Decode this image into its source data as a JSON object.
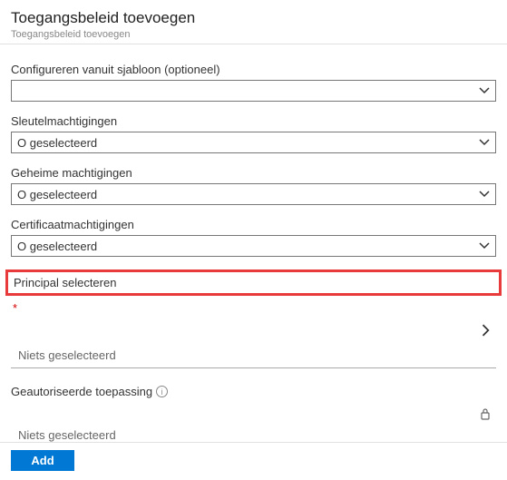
{
  "header": {
    "title": "Toegangsbeleid toevoegen",
    "subtitle": "Toegangsbeleid toevoegen"
  },
  "fields": {
    "template": {
      "label": "Configureren vanuit sjabloon (optioneel)",
      "value": ""
    },
    "key_permissions": {
      "label": "Sleutelmachtigingen",
      "value": "O geselecteerd"
    },
    "secret_permissions": {
      "label": "Geheime machtigingen",
      "value": "O geselecteerd"
    },
    "certificate_permissions": {
      "label": "Certificaatmachtigingen",
      "value": "O geselecteerd"
    },
    "principal": {
      "label": "Principal selecteren",
      "required": "*",
      "value": "Niets geselecteerd"
    },
    "authorized_app": {
      "label": "Geautoriseerde toepassing",
      "info": "i",
      "value": "Niets geselecteerd"
    }
  },
  "footer": {
    "add_label": "Add"
  }
}
